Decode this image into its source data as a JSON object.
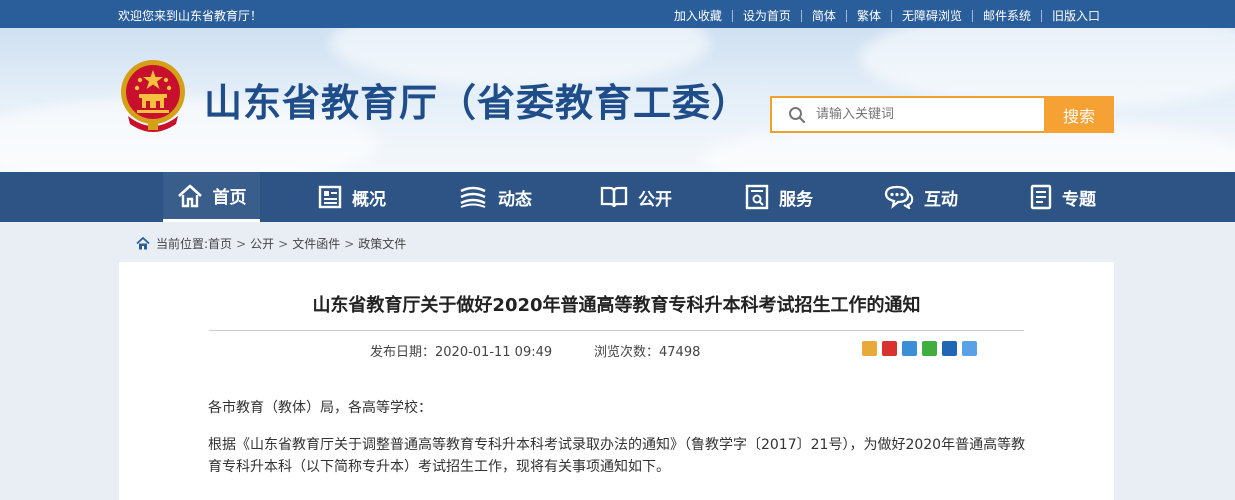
{
  "topbar": {
    "welcome": "欢迎您来到山东省教育厅！",
    "links": [
      "加入收藏",
      "设为首页",
      "简体",
      "繁体",
      "无障碍浏览",
      "邮件系统",
      "旧版入口"
    ]
  },
  "header": {
    "site_title": "山东省教育厅（省委教育工委）",
    "search_placeholder": "请输入关键词",
    "search_button": "搜索"
  },
  "nav": {
    "items": [
      {
        "label": "首页",
        "icon": "home-icon"
      },
      {
        "label": "概况",
        "icon": "overview-icon"
      },
      {
        "label": "动态",
        "icon": "news-icon"
      },
      {
        "label": "公开",
        "icon": "book-icon"
      },
      {
        "label": "服务",
        "icon": "service-icon"
      },
      {
        "label": "互动",
        "icon": "chat-icon"
      },
      {
        "label": "专题",
        "icon": "topic-icon"
      }
    ]
  },
  "breadcrumb": {
    "prefix": "当前位置:",
    "items": [
      "首页",
      "公开",
      "文件函件",
      "政策文件"
    ]
  },
  "article": {
    "title": "山东省教育厅关于做好2020年普通高等教育专科升本科考试招生工作的通知",
    "publish_date": "发布日期：2020-01-11 09:49",
    "views": "浏览次数：47498",
    "salutation": "各市教育（教体）局，各高等学校：",
    "body_1": "根据《山东省教育厅关于调整普通高等教育专科升本科考试录取办法的通知》（鲁教学字〔2017〕21号），为做好2020年普通高等教育专科升本科（以下简称专升本）考试招生工作，现将有关事项通知如下。"
  },
  "colors": {
    "topbar": "#2a5e9b",
    "nav": "#2d5485",
    "accent": "#f5a133",
    "title": "#1f4d8a"
  }
}
